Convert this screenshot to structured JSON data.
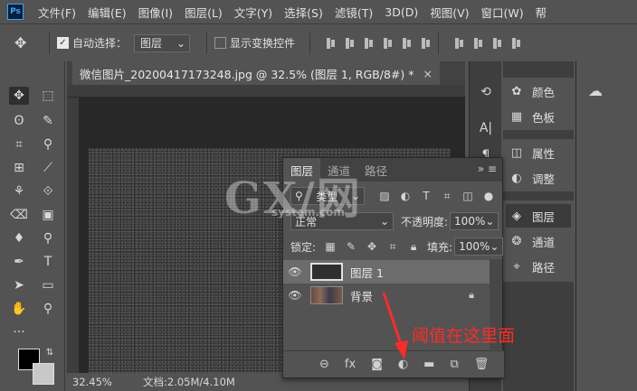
{
  "app": {
    "logo": "Ps"
  },
  "menu": [
    "文件(F)",
    "编辑(E)",
    "图像(I)",
    "图层(L)",
    "文字(Y)",
    "选择(S)",
    "滤镜(T)",
    "3D(D)",
    "视图(V)",
    "窗口(W)",
    "帮"
  ],
  "options": {
    "auto_select_label": "自动选择：",
    "auto_select_value": "图层",
    "show_transform_label": "显示变换控件"
  },
  "document_tab": {
    "title": "微信图片_20200417173248.jpg @ 32.5% (图层 1, RGB/8#) *",
    "close": "×"
  },
  "status": {
    "zoom": "32.45%",
    "doc": "文档:2.05M/4.10M"
  },
  "dock": {
    "items": [
      {
        "label": "颜色",
        "icon": "palette-icon"
      },
      {
        "label": "色板",
        "icon": "swatches-icon"
      },
      {
        "label": "属性",
        "icon": "properties-icon"
      },
      {
        "label": "调整",
        "icon": "adjustments-icon"
      },
      {
        "label": "图层",
        "icon": "layers-icon"
      },
      {
        "label": "通道",
        "icon": "channels-icon"
      },
      {
        "label": "路径",
        "icon": "paths-icon"
      }
    ]
  },
  "layers_panel": {
    "tabs": [
      "图层",
      "通道",
      "路径"
    ],
    "filter_label": "类型",
    "blend_mode": "正常",
    "opacity_label": "不透明度:",
    "opacity_value": "100%",
    "lock_label": "锁定:",
    "fill_label": "填充:",
    "fill_value": "100%",
    "layers": [
      {
        "name": "图层 1",
        "selected": true
      },
      {
        "name": "背景",
        "selected": false,
        "locked": true
      }
    ]
  },
  "watermark": {
    "main": "GX/网",
    "sub": "system.com"
  },
  "annotation": {
    "text": "阈值在这里面",
    "color": "#ff2a2a"
  }
}
